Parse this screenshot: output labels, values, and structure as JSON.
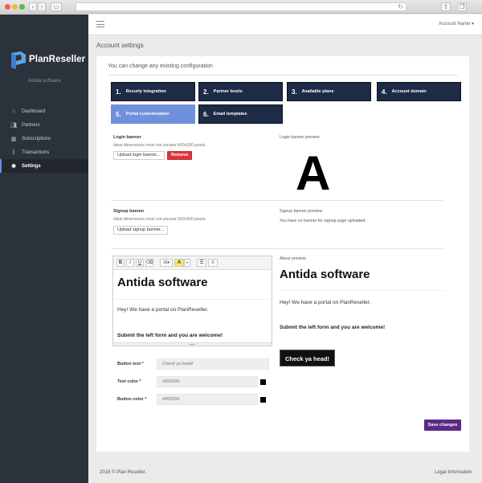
{
  "brand": {
    "name": "PlanReseller",
    "subtitle": "Antida software"
  },
  "sidebar": {
    "items": [
      {
        "label": "Dashboard",
        "icon": "home-icon",
        "active": false
      },
      {
        "label": "Partners",
        "icon": "users-icon",
        "active": false
      },
      {
        "label": "Subscriptions",
        "icon": "grid-icon",
        "active": false
      },
      {
        "label": "Transactions",
        "icon": "chart-icon",
        "active": false
      },
      {
        "label": "Settings",
        "icon": "wrench-icon",
        "active": true
      }
    ]
  },
  "topbar": {
    "account": "Account Name ▾"
  },
  "page": {
    "title": "Account settings",
    "subtitle": "You can change any existing configuration"
  },
  "tabs": [
    {
      "num": "1.",
      "label": "Recurly integration",
      "active": false
    },
    {
      "num": "2.",
      "label": "Partner levels",
      "active": false
    },
    {
      "num": "3.",
      "label": "Available plans",
      "active": false
    },
    {
      "num": "4.",
      "label": "Account domain",
      "active": false
    },
    {
      "num": "5.",
      "label": "Portal customization",
      "active": true
    },
    {
      "num": "6.",
      "label": "Email templates",
      "active": false
    }
  ],
  "login_banner": {
    "label": "Login banner",
    "note": "Ideal dimensions must not exceed 400x200 pixels.",
    "upload_label": "Upload login banner...",
    "remove_label": "Remove",
    "preview_label": "Login banner preview",
    "preview_glyph": "A"
  },
  "signup_banner": {
    "label": "Signup banner",
    "note": "Ideal dimensions must not exceed 600x300 pixels.",
    "upload_label": "Upload signup banner...",
    "preview_label": "Signup banner preview",
    "preview_text": "You have no banner for signup page uploaded."
  },
  "editor": {
    "toolbar": {
      "bold": "B",
      "italic": "I",
      "underline": "U",
      "size": "16▾",
      "color": "A"
    },
    "heading": "Antida software",
    "paragraph": "Hey! We have a portal on PlanReseller.",
    "bold_line": "Submit the left form and you are welcome!"
  },
  "about_preview": {
    "label": "About preview",
    "heading": "Antida software",
    "paragraph": "Hey! We have a portal on PlanReseller.",
    "bold_line": "Submit the left form and you are welcome!",
    "button": "Check ya head!"
  },
  "form": {
    "button_text_label": "Button text *",
    "button_text_value": "Check ya head!",
    "text_color_label": "Text color *",
    "text_color_value": "#000000",
    "button_color_label": "Button color *",
    "button_color_value": "#000000"
  },
  "save_label": "Save changes",
  "footer": {
    "copyright": "2016 © Plan Reseller.",
    "legal": "Legal Information"
  },
  "colors": {
    "sidebar": "#2c323b",
    "tab": "#1d2b47",
    "tab_active": "#6f90dc",
    "save": "#5b2a86",
    "remove": "#d9363e"
  }
}
